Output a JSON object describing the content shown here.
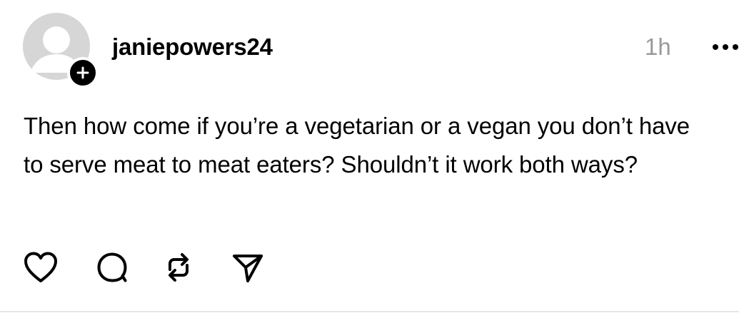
{
  "post": {
    "username": "janiepowers24",
    "time": "1h",
    "text": "Then how come if you’re a vegetarian or a vegan you don’t have to serve meat to meat eaters? Shouldn’t it work both ways?",
    "icons": {
      "avatar": "default-avatar-icon",
      "follow": "plus-icon",
      "more": "more-horizontal-icon",
      "like": "heart-icon",
      "reply": "comment-icon",
      "repost": "repost-icon",
      "share": "send-icon"
    }
  }
}
